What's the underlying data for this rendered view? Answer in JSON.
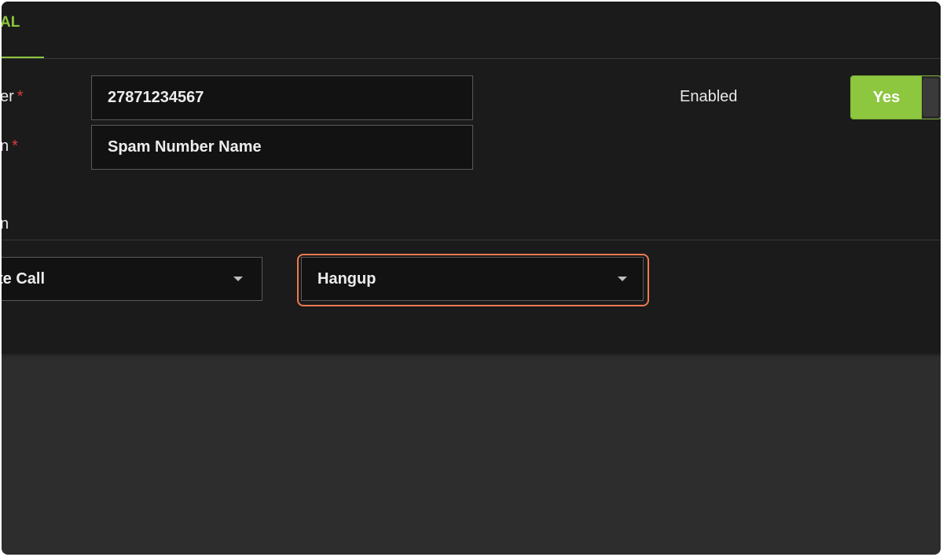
{
  "tabs": {
    "active_label": "AL"
  },
  "form": {
    "number_label": "er",
    "number_value": "27871234567",
    "name_label": "n",
    "name_value": "Spam Number Name",
    "required_marker": "*",
    "enabled_label": "Enabled",
    "enabled_value": "Yes",
    "section_label": "n"
  },
  "actions": {
    "first_select_value": "te Call",
    "second_select_value": "Hangup"
  },
  "colors": {
    "accent": "#8dc63f",
    "highlight": "#f07a4f",
    "required": "#e03a3a",
    "panel": "#1b1b1b",
    "background": "#2d2d2d"
  }
}
